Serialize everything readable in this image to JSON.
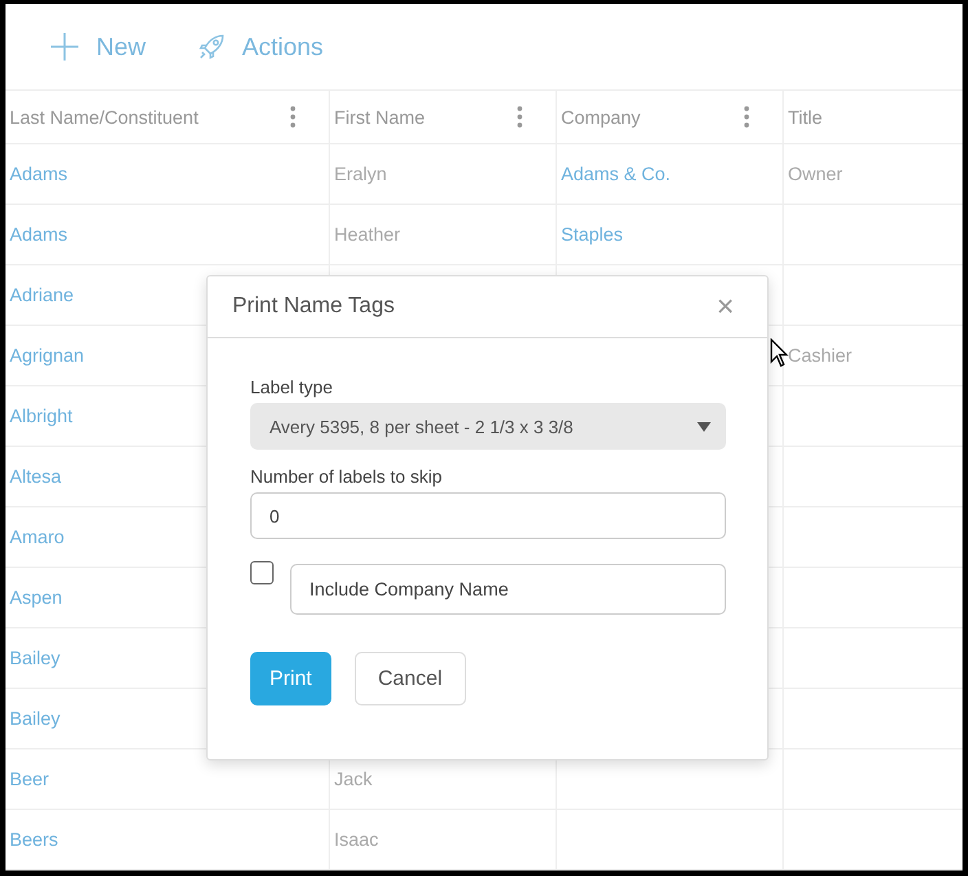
{
  "toolbar": {
    "buttons": [
      {
        "kind": "new",
        "label": "New"
      },
      {
        "kind": "actions",
        "label": "Actions"
      }
    ]
  },
  "table": {
    "columns": [
      {
        "label": "Last Name/Constituent",
        "menu": true
      },
      {
        "label": "First Name",
        "menu": true
      },
      {
        "label": "Company",
        "menu": true
      },
      {
        "label": "Title",
        "menu": false
      }
    ],
    "rows": [
      {
        "last_name": "Adams",
        "first_name": "Eralyn",
        "company": "Adams & Co.",
        "title": "Owner"
      },
      {
        "last_name": "Adams",
        "first_name": "Heather",
        "company": "Staples"
      },
      {
        "last_name": "Adriane"
      },
      {
        "last_name": "Agrignan",
        "title": "Cashier"
      },
      {
        "last_name": "Albright"
      },
      {
        "last_name": "Altesa"
      },
      {
        "last_name": "Amaro"
      },
      {
        "last_name": "Aspen"
      },
      {
        "last_name": "Bailey"
      },
      {
        "last_name": "Bailey"
      },
      {
        "last_name": "Beer",
        "first_name": "Jack"
      },
      {
        "last_name": "Beers",
        "first_name": "Isaac"
      }
    ]
  },
  "dialog": {
    "title": "Print Name Tags",
    "close": "×",
    "label_type": {
      "label": "Label type",
      "value": "Avery 5395, 8 per sheet - 2 1/3 x 3 3/8"
    },
    "skip": {
      "label": "Number of labels to skip",
      "value": "0"
    },
    "include_company": {
      "checked": false,
      "label": "Include Company Name"
    },
    "buttons": [
      {
        "kind": "primary",
        "label": "Print"
      },
      {
        "kind": "secondary",
        "label": "Cancel"
      }
    ]
  }
}
